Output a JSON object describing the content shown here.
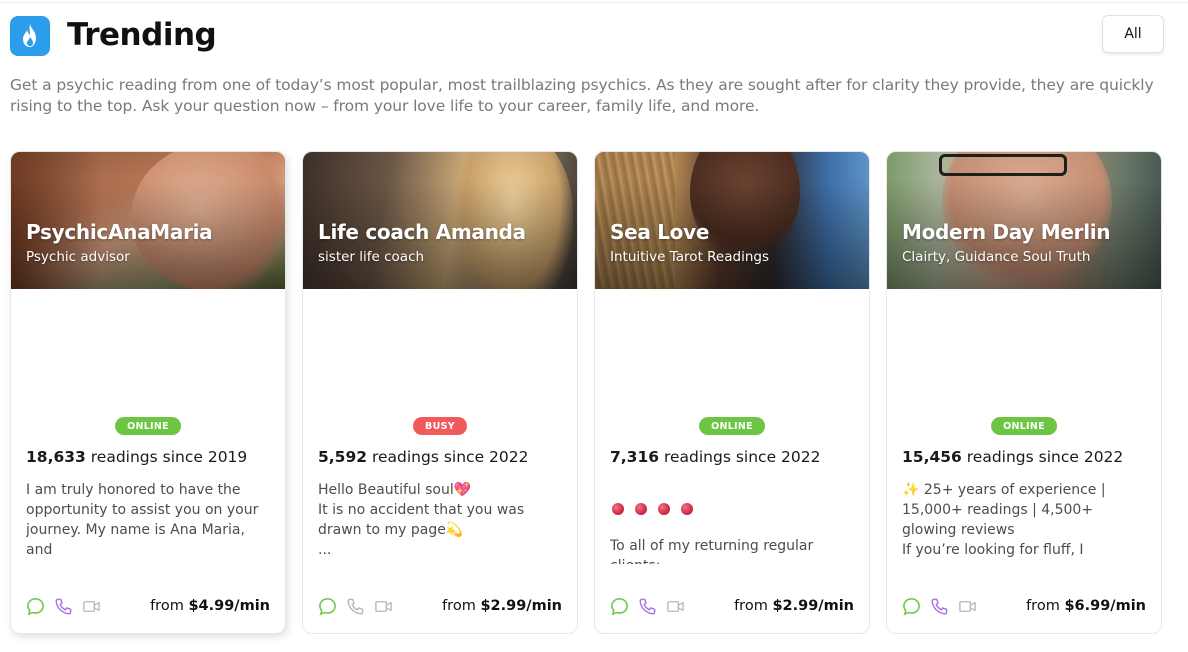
{
  "header": {
    "title": "Trending",
    "all_button": "All",
    "icon": "fire-icon",
    "accent": "#2c9dea"
  },
  "intro": "Get a psychic reading from one of today’s most popular, most trailblazing psychics. As they are sought after for clarity they provide, they are quickly rising to the top. Ask your question now – from your love life to your career, family life, and more.",
  "status_colors": {
    "ONLINE": "#6cc644",
    "BUSY": "#f05a5a"
  },
  "cards": [
    {
      "name": "PsychicAnaMaria",
      "subtitle": "Psychic advisor",
      "status": "ONLINE",
      "readings_count": "18,633",
      "readings_text": "readings since 2019",
      "bio": "I am truly honored to have the opportunity to assist you on your journey. My name is Ana Maria, and",
      "price_from": "from",
      "price": "$4.99/min",
      "chat_color": "#6cc644",
      "phone_color": "#a774e0",
      "video_color": "#b7b7b7"
    },
    {
      "name": "Life coach Amanda",
      "subtitle": "sister life coach",
      "status": "BUSY",
      "readings_count": "5,592",
      "readings_text": "readings since 2022",
      "bio": "Hello Beautiful soul💖\nIt is no accident that you was drawn to my page💫\n...",
      "price_from": "from",
      "price": "$2.99/min",
      "chat_color": "#6cc644",
      "phone_color": "#b7b7b7",
      "video_color": "#b7b7b7"
    },
    {
      "name": "Sea Love",
      "subtitle": "Intuitive Tarot Readings",
      "status": "ONLINE",
      "readings_count": "7,316",
      "readings_text": "readings since 2022",
      "bio": "To all of my returning regular clients:\nTHANK YOU. I appreciate each an…",
      "price_from": "from",
      "price": "$2.99/min",
      "chat_color": "#6cc644",
      "phone_color": "#a774e0",
      "video_color": "#b7b7b7"
    },
    {
      "name": "Modern Day Merlin",
      "subtitle": "Clairty, Guidance Soul Truth",
      "status": "ONLINE",
      "readings_count": "15,456",
      "readings_text": "readings since 2022",
      "bio": "✨ 25+ years of experience | 15,000+ readings | 4,500+ glowing reviews\nIf you’re looking for fluff, I",
      "price_from": "from",
      "price": "$6.99/min",
      "chat_color": "#6cc644",
      "phone_color": "#a774e0",
      "video_color": "#b7b7b7"
    }
  ]
}
